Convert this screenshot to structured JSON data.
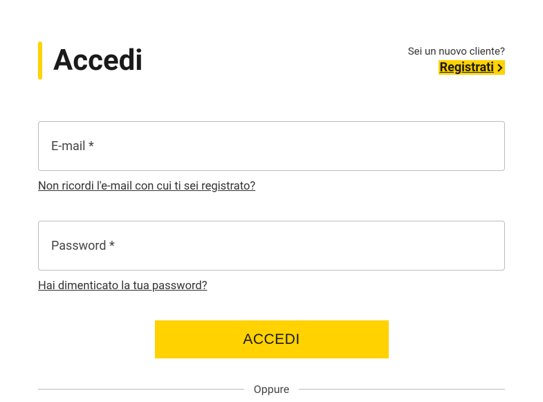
{
  "header": {
    "title": "Accedi",
    "register_prompt": "Sei un nuovo cliente?",
    "register_link": "Registrati"
  },
  "form": {
    "email": {
      "label": "E-mail *",
      "value": "",
      "help_link": "Non ricordi l'e-mail con cui ti sei registrato?"
    },
    "password": {
      "label": "Password *",
      "value": "",
      "help_link": "Hai dimenticato la tua password?"
    },
    "submit_label": "ACCEDI"
  },
  "divider": {
    "text": "Oppure"
  },
  "colors": {
    "accent": "#ffd200"
  }
}
